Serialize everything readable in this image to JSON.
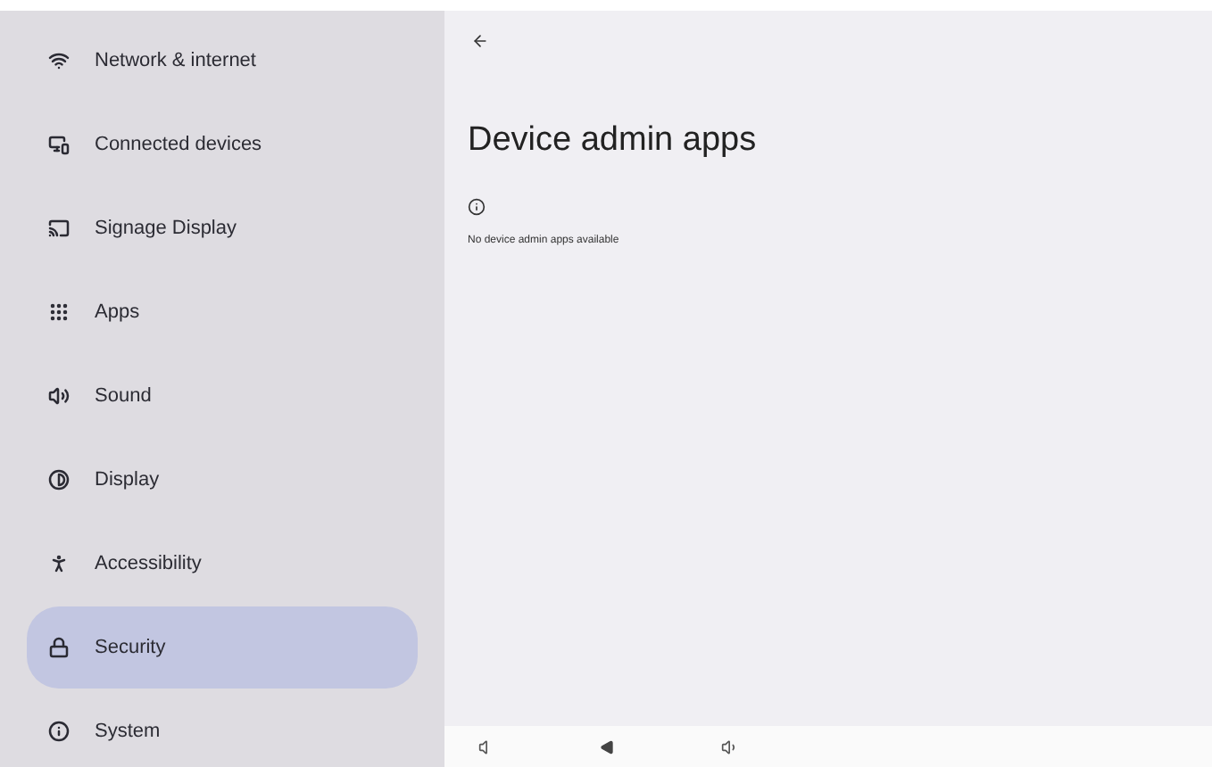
{
  "sidebar": {
    "items": [
      {
        "kind": "network",
        "label": "Network & internet",
        "selected": false
      },
      {
        "kind": "devices",
        "label": "Connected devices",
        "selected": false
      },
      {
        "kind": "signage",
        "label": "Signage Display",
        "selected": false
      },
      {
        "kind": "apps",
        "label": "Apps",
        "selected": false
      },
      {
        "kind": "sound",
        "label": "Sound",
        "selected": false
      },
      {
        "kind": "display",
        "label": "Display",
        "selected": false
      },
      {
        "kind": "accessibility",
        "label": "Accessibility",
        "selected": false
      },
      {
        "kind": "security",
        "label": "Security",
        "selected": true
      },
      {
        "kind": "system",
        "label": "System",
        "selected": false
      }
    ]
  },
  "page": {
    "title": "Device admin apps",
    "message": "No device admin apps available"
  }
}
